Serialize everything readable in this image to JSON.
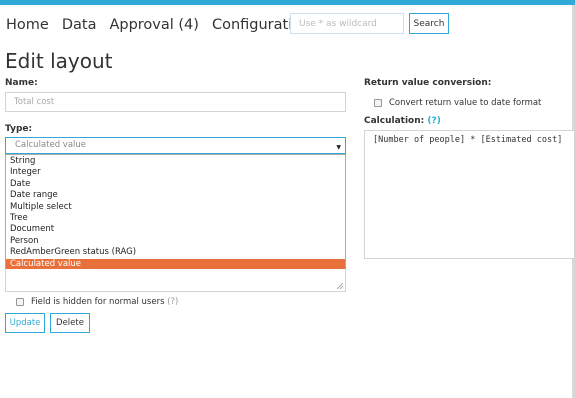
{
  "nav": {
    "home": "Home",
    "data": "Data",
    "approval": "Approval (4)",
    "configuration": "Configuration"
  },
  "search": {
    "placeholder": "Use * as wildcard",
    "button": "Search"
  },
  "page": {
    "title": "Edit layout"
  },
  "form": {
    "name_label": "Name:",
    "name_value": "Total cost",
    "type_label": "Type:",
    "type_selected": "Calculated value",
    "type_options": [
      "String",
      "Integer",
      "Date",
      "Date range",
      "Multiple select",
      "Tree",
      "Document",
      "Person",
      "RedAmberGreen status (RAG)",
      "Calculated value"
    ],
    "hidden_label": "Field is hidden for normal users",
    "hidden_help": "(?)",
    "update_button": "Update",
    "delete_button": "Delete"
  },
  "right": {
    "return_label": "Return value conversion:",
    "convert_label": "Convert return value to date format",
    "calc_label": "Calculation:",
    "calc_help": "(?)",
    "calc_value": "[Number of people] * [Estimated cost]"
  },
  "colors": {
    "accent": "#2fa9d8",
    "selected_option": "#e8703a"
  }
}
